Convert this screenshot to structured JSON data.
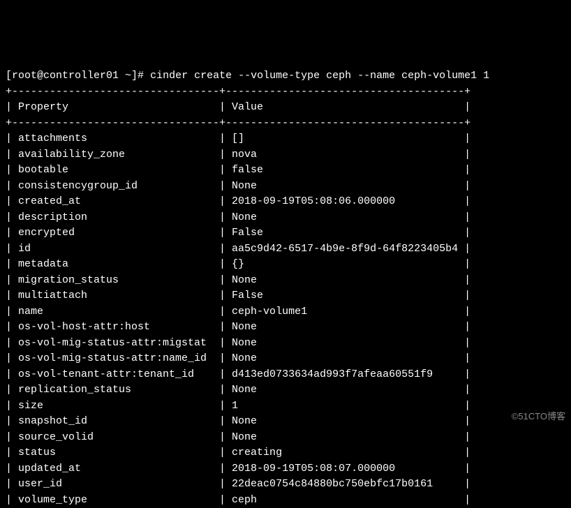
{
  "prompt": {
    "user_host": "[root@controller01 ~]#",
    "command": "cinder create --volume-type ceph --name ceph-volume1 1"
  },
  "table": {
    "header": {
      "left": "Property",
      "right": "Value"
    },
    "rows": [
      {
        "prop": "attachments",
        "val": "[]"
      },
      {
        "prop": "availability_zone",
        "val": "nova"
      },
      {
        "prop": "bootable",
        "val": "false"
      },
      {
        "prop": "consistencygroup_id",
        "val": "None"
      },
      {
        "prop": "created_at",
        "val": "2018-09-19T05:08:06.000000"
      },
      {
        "prop": "description",
        "val": "None"
      },
      {
        "prop": "encrypted",
        "val": "False"
      },
      {
        "prop": "id",
        "val": "aa5c9d42-6517-4b9e-8f9d-64f8223405b4"
      },
      {
        "prop": "metadata",
        "val": "{}"
      },
      {
        "prop": "migration_status",
        "val": "None"
      },
      {
        "prop": "multiattach",
        "val": "False"
      },
      {
        "prop": "name",
        "val": "ceph-volume1"
      },
      {
        "prop": "os-vol-host-attr:host",
        "val": "None"
      },
      {
        "prop": "os-vol-mig-status-attr:migstat",
        "val": "None"
      },
      {
        "prop": "os-vol-mig-status-attr:name_id",
        "val": "None"
      },
      {
        "prop": "os-vol-tenant-attr:tenant_id",
        "val": "d413ed0733634ad993f7afeaa60551f9"
      },
      {
        "prop": "replication_status",
        "val": "None"
      },
      {
        "prop": "size",
        "val": "1"
      },
      {
        "prop": "snapshot_id",
        "val": "None"
      },
      {
        "prop": "source_volid",
        "val": "None"
      },
      {
        "prop": "status",
        "val": "creating"
      },
      {
        "prop": "updated_at",
        "val": "2018-09-19T05:08:07.000000"
      },
      {
        "prop": "user_id",
        "val": "22deac0754c84880bc750ebfc17b0161"
      },
      {
        "prop": "volume_type",
        "val": "ceph"
      }
    ],
    "col1_width": 33,
    "col2_width": 38
  },
  "watermark": "©51CTO博客"
}
